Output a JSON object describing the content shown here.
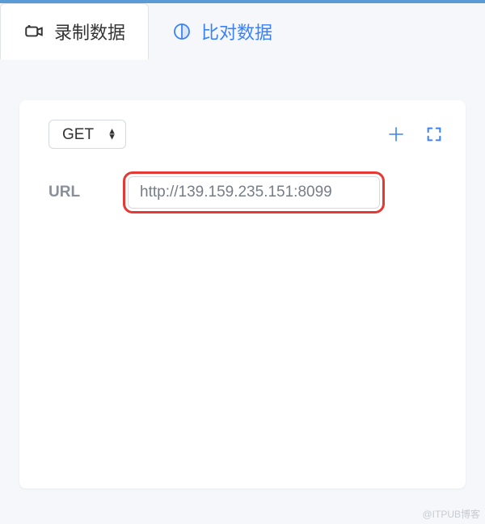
{
  "tabs": [
    {
      "label": "录制数据",
      "active": true
    },
    {
      "label": "比对数据",
      "active": false
    }
  ],
  "method": {
    "selected": "GET"
  },
  "url": {
    "label": "URL",
    "value": "http://139.159.235.151:8099"
  },
  "watermark": "@ITPUB博客"
}
